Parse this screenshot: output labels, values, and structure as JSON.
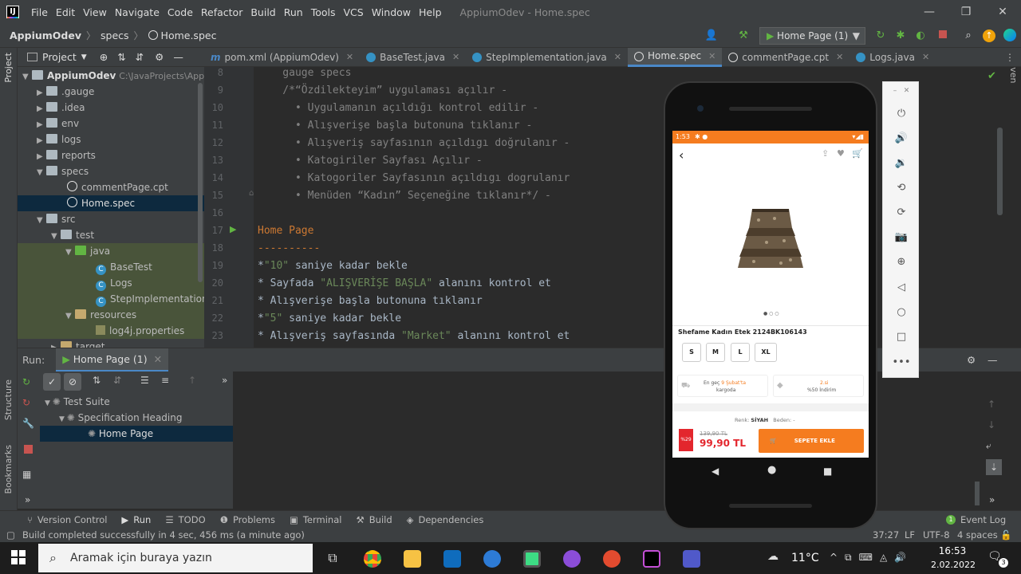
{
  "menubar": {
    "items": [
      "File",
      "Edit",
      "View",
      "Navigate",
      "Code",
      "Refactor",
      "Build",
      "Run",
      "Tools",
      "VCS",
      "Window",
      "Help"
    ],
    "window_title": "AppiumOdev - Home.spec"
  },
  "navbar": {
    "breadcrumb": [
      "AppiumOdev",
      "specs",
      "Home.spec"
    ],
    "run_config": "Home Page (1)"
  },
  "project": {
    "header": "Project",
    "tree": [
      {
        "label": "AppiumOdev",
        "path": "C:\\JavaProjects\\Appi"
      },
      {
        "label": ".gauge"
      },
      {
        "label": ".idea"
      },
      {
        "label": "env"
      },
      {
        "label": "logs"
      },
      {
        "label": "reports"
      },
      {
        "label": "specs"
      },
      {
        "label": "commentPage.cpt"
      },
      {
        "label": "Home.spec"
      },
      {
        "label": "src"
      },
      {
        "label": "test"
      },
      {
        "label": "java"
      },
      {
        "label": "BaseTest"
      },
      {
        "label": "Logs"
      },
      {
        "label": "StepImplementation"
      },
      {
        "label": "resources"
      },
      {
        "label": "log4j.properties"
      },
      {
        "label": "target"
      }
    ]
  },
  "tabs": [
    {
      "label": "pom.xml (AppiumOdev)"
    },
    {
      "label": "BaseTest.java"
    },
    {
      "label": "StepImplementation.java"
    },
    {
      "label": "Home.spec"
    },
    {
      "label": "commentPage.cpt"
    },
    {
      "label": "Logs.java"
    }
  ],
  "editor": {
    "line_numbers": [
      "8",
      "9",
      "10",
      "11",
      "12",
      "13",
      "14",
      "15",
      "16",
      "17",
      "18",
      "19",
      "20",
      "21",
      "22",
      "23"
    ],
    "lines": [
      "    gauge specs",
      "    /*“Özdilekteyim” uygulaması açılır -",
      "      • Uygulamanın açıldığı kontrol edilir -",
      "      • Alışverişe başla butonuna tıklanır -",
      "      • Alışveriş sayfasının açıldıgı doğrulanır -",
      "      • Katogiriler Sayfası Açılır -",
      "      • Katogoriler Sayfasının açıldıgı dogrulanır",
      "      • Menüden “Kadın” Seçeneğine tıklanır*/ -",
      "",
      "Home Page",
      "----------",
      "",
      "",
      "* Alışverişe başla butonuna tıklanır",
      "",
      "* Alışveriş sayfasında "
    ],
    "line19_a": "*",
    "line19_str": "\"10\"",
    "line19_b": " saniye kadar bekle",
    "line20_a": "* Sayfada ",
    "line20_str": "\"ALIŞVERİŞE BAŞLA\"",
    "line20_b": " alanını kontrol et",
    "line22_a": "*",
    "line22_str": "\"5\"",
    "line22_b": " saniye kadar bekle",
    "line23_str": "\"Market\"",
    "line23_b": " alanını kontrol et"
  },
  "run": {
    "label": "Run:",
    "tab": "Home Page (1)",
    "tree": [
      "Test Suite",
      "Specification Heading",
      "Home Page"
    ]
  },
  "toolwindows": [
    "Version Control",
    "Run",
    "TODO",
    "Problems",
    "Terminal",
    "Build",
    "Dependencies"
  ],
  "event_log": "Event Log",
  "status": {
    "message": "Build completed successfully in 4 sec, 456 ms (a minute ago)",
    "position": "37:27",
    "line_sep": "LF",
    "encoding": "UTF-8",
    "indent": "4 spaces"
  },
  "phone": {
    "status_time": "1:53",
    "product_name": "Shefame Kadın Etek 2124BK106143",
    "sizes": [
      "S",
      "M",
      "L",
      "XL"
    ],
    "delivery_a": "En geç ",
    "delivery_date": "9 Şubat'ta",
    "delivery_b": "kargoda",
    "promo_a": "2.si",
    "promo_b": "%50 İndirim",
    "color_label": "Renk:",
    "color_value": "SİYAH",
    "size_label": "Beden: -",
    "discount_badge": "%29",
    "old_price": "139,90 TL",
    "price": "99,90 TL",
    "add_to_cart": "SEPETE EKLE"
  },
  "taskbar": {
    "search_placeholder": "Aramak için buraya yazın",
    "temperature": "11°C",
    "time": "16:53",
    "date": "2.02.2022",
    "notif_count": "3"
  },
  "sidebar_labels": {
    "project": "Project",
    "structure": "Structure",
    "bookmarks": "Bookmarks",
    "maven": "Maven"
  }
}
